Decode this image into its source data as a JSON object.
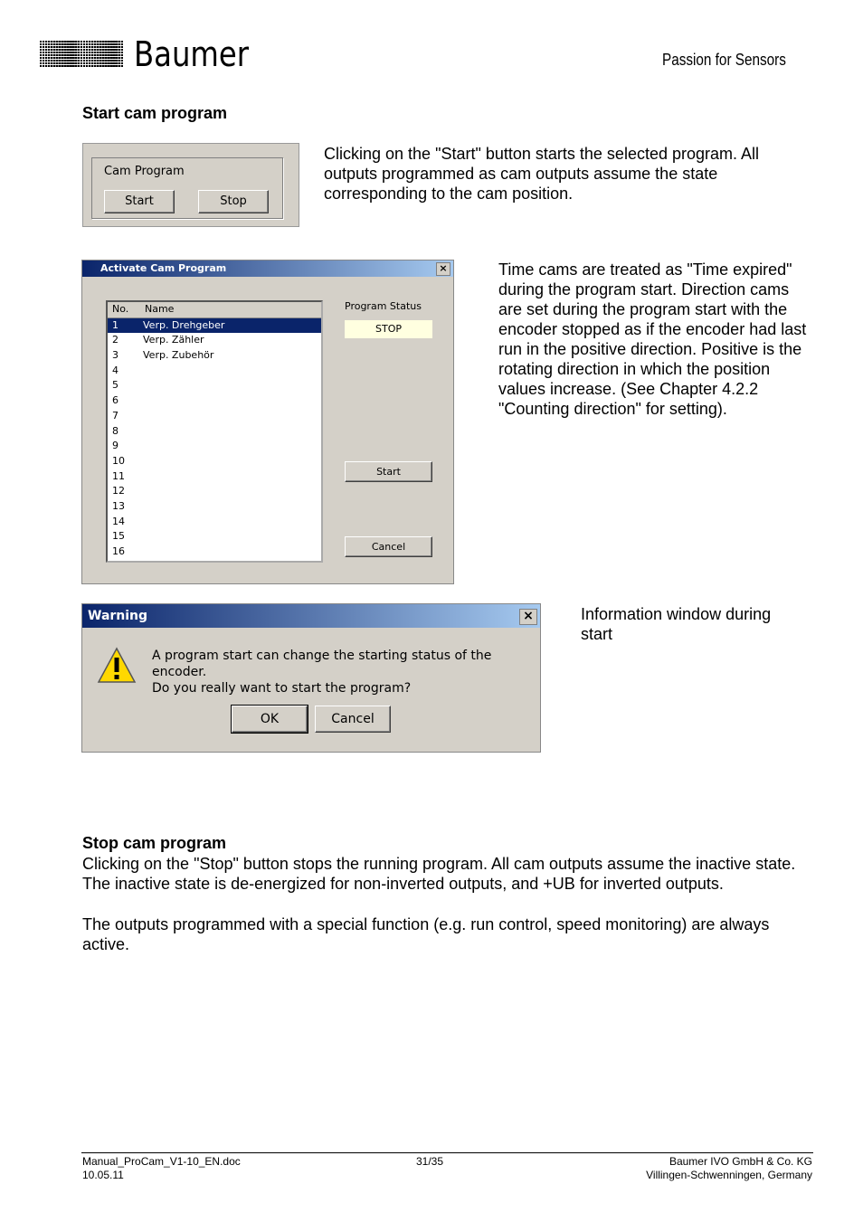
{
  "header": {
    "brand": "Baumer",
    "tagline": "Passion for Sensors"
  },
  "section1": {
    "heading": "Start cam program",
    "para1": "Clicking on the \"Start\" button starts the selected program. All outputs programmed as cam outputs assume the state corresponding to the cam position.",
    "para2": "Time cams are treated as \"Time expired\" during the program start. Direction cams are set during the program start with the encoder stopped as if the encoder had last run in the positive direction. Positive is the rotating direction in which the position values increase. (See Chapter 4.2.2 \"Counting direction\" for setting).",
    "para3": "Information window during start"
  },
  "cam_box": {
    "label": "Cam Program",
    "start": "Start",
    "stop": "Stop"
  },
  "dialog": {
    "title": "Activate Cam Program",
    "close": "×",
    "col_no": "No.",
    "col_name": "Name",
    "rows": [
      {
        "no": "1",
        "name": "Verp. Drehgeber"
      },
      {
        "no": "2",
        "name": "Verp. Zähler"
      },
      {
        "no": "3",
        "name": "Verp. Zubehör"
      },
      {
        "no": "4",
        "name": ""
      },
      {
        "no": "5",
        "name": ""
      },
      {
        "no": "6",
        "name": ""
      },
      {
        "no": "7",
        "name": ""
      },
      {
        "no": "8",
        "name": ""
      },
      {
        "no": "9",
        "name": ""
      },
      {
        "no": "10",
        "name": ""
      },
      {
        "no": "11",
        "name": ""
      },
      {
        "no": "12",
        "name": ""
      },
      {
        "no": "13",
        "name": ""
      },
      {
        "no": "14",
        "name": ""
      },
      {
        "no": "15",
        "name": ""
      },
      {
        "no": "16",
        "name": ""
      }
    ],
    "status_label": "Program Status",
    "status_value": "STOP",
    "start": "Start",
    "cancel": "Cancel"
  },
  "warning": {
    "title": "Warning",
    "close": "×",
    "line1": "A program start can change the starting status of the encoder.",
    "line2": "Do you really want to start the program?",
    "ok": "OK",
    "cancel": "Cancel"
  },
  "section2": {
    "heading": "Stop cam program",
    "para1": "Clicking on the \"Stop\" button stops the running program. All cam outputs assume the inactive state. The inactive state is de-energized for non-inverted outputs, and +UB for inverted outputs.",
    "para2": "The outputs programmed with a special function (e.g. run control, speed monitoring) are always active."
  },
  "footer": {
    "file": "Manual_ProCam_V1-10_EN.doc",
    "date": "10.05.11",
    "page": "31/35",
    "company": "Baumer IVO GmbH & Co. KG",
    "location": "Villingen-Schwenningen, Germany"
  }
}
